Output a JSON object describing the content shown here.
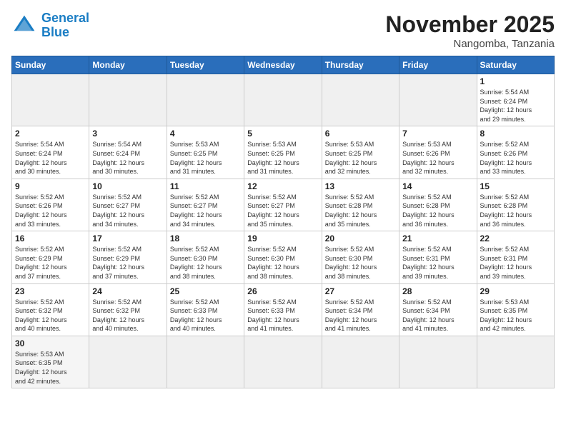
{
  "header": {
    "logo_line1": "General",
    "logo_line2": "Blue",
    "month_title": "November 2025",
    "location": "Nangomba, Tanzania"
  },
  "weekdays": [
    "Sunday",
    "Monday",
    "Tuesday",
    "Wednesday",
    "Thursday",
    "Friday",
    "Saturday"
  ],
  "days": [
    {
      "num": "",
      "info": ""
    },
    {
      "num": "",
      "info": ""
    },
    {
      "num": "",
      "info": ""
    },
    {
      "num": "",
      "info": ""
    },
    {
      "num": "",
      "info": ""
    },
    {
      "num": "",
      "info": ""
    },
    {
      "num": "1",
      "info": "Sunrise: 5:54 AM\nSunset: 6:24 PM\nDaylight: 12 hours\nand 29 minutes."
    },
    {
      "num": "2",
      "info": "Sunrise: 5:54 AM\nSunset: 6:24 PM\nDaylight: 12 hours\nand 30 minutes."
    },
    {
      "num": "3",
      "info": "Sunrise: 5:54 AM\nSunset: 6:24 PM\nDaylight: 12 hours\nand 30 minutes."
    },
    {
      "num": "4",
      "info": "Sunrise: 5:53 AM\nSunset: 6:25 PM\nDaylight: 12 hours\nand 31 minutes."
    },
    {
      "num": "5",
      "info": "Sunrise: 5:53 AM\nSunset: 6:25 PM\nDaylight: 12 hours\nand 31 minutes."
    },
    {
      "num": "6",
      "info": "Sunrise: 5:53 AM\nSunset: 6:25 PM\nDaylight: 12 hours\nand 32 minutes."
    },
    {
      "num": "7",
      "info": "Sunrise: 5:53 AM\nSunset: 6:26 PM\nDaylight: 12 hours\nand 32 minutes."
    },
    {
      "num": "8",
      "info": "Sunrise: 5:52 AM\nSunset: 6:26 PM\nDaylight: 12 hours\nand 33 minutes."
    },
    {
      "num": "9",
      "info": "Sunrise: 5:52 AM\nSunset: 6:26 PM\nDaylight: 12 hours\nand 33 minutes."
    },
    {
      "num": "10",
      "info": "Sunrise: 5:52 AM\nSunset: 6:27 PM\nDaylight: 12 hours\nand 34 minutes."
    },
    {
      "num": "11",
      "info": "Sunrise: 5:52 AM\nSunset: 6:27 PM\nDaylight: 12 hours\nand 34 minutes."
    },
    {
      "num": "12",
      "info": "Sunrise: 5:52 AM\nSunset: 6:27 PM\nDaylight: 12 hours\nand 35 minutes."
    },
    {
      "num": "13",
      "info": "Sunrise: 5:52 AM\nSunset: 6:28 PM\nDaylight: 12 hours\nand 35 minutes."
    },
    {
      "num": "14",
      "info": "Sunrise: 5:52 AM\nSunset: 6:28 PM\nDaylight: 12 hours\nand 36 minutes."
    },
    {
      "num": "15",
      "info": "Sunrise: 5:52 AM\nSunset: 6:28 PM\nDaylight: 12 hours\nand 36 minutes."
    },
    {
      "num": "16",
      "info": "Sunrise: 5:52 AM\nSunset: 6:29 PM\nDaylight: 12 hours\nand 37 minutes."
    },
    {
      "num": "17",
      "info": "Sunrise: 5:52 AM\nSunset: 6:29 PM\nDaylight: 12 hours\nand 37 minutes."
    },
    {
      "num": "18",
      "info": "Sunrise: 5:52 AM\nSunset: 6:30 PM\nDaylight: 12 hours\nand 38 minutes."
    },
    {
      "num": "19",
      "info": "Sunrise: 5:52 AM\nSunset: 6:30 PM\nDaylight: 12 hours\nand 38 minutes."
    },
    {
      "num": "20",
      "info": "Sunrise: 5:52 AM\nSunset: 6:30 PM\nDaylight: 12 hours\nand 38 minutes."
    },
    {
      "num": "21",
      "info": "Sunrise: 5:52 AM\nSunset: 6:31 PM\nDaylight: 12 hours\nand 39 minutes."
    },
    {
      "num": "22",
      "info": "Sunrise: 5:52 AM\nSunset: 6:31 PM\nDaylight: 12 hours\nand 39 minutes."
    },
    {
      "num": "23",
      "info": "Sunrise: 5:52 AM\nSunset: 6:32 PM\nDaylight: 12 hours\nand 40 minutes."
    },
    {
      "num": "24",
      "info": "Sunrise: 5:52 AM\nSunset: 6:32 PM\nDaylight: 12 hours\nand 40 minutes."
    },
    {
      "num": "25",
      "info": "Sunrise: 5:52 AM\nSunset: 6:33 PM\nDaylight: 12 hours\nand 40 minutes."
    },
    {
      "num": "26",
      "info": "Sunrise: 5:52 AM\nSunset: 6:33 PM\nDaylight: 12 hours\nand 41 minutes."
    },
    {
      "num": "27",
      "info": "Sunrise: 5:52 AM\nSunset: 6:34 PM\nDaylight: 12 hours\nand 41 minutes."
    },
    {
      "num": "28",
      "info": "Sunrise: 5:52 AM\nSunset: 6:34 PM\nDaylight: 12 hours\nand 41 minutes."
    },
    {
      "num": "29",
      "info": "Sunrise: 5:53 AM\nSunset: 6:35 PM\nDaylight: 12 hours\nand 42 minutes."
    },
    {
      "num": "30",
      "info": "Sunrise: 5:53 AM\nSunset: 6:35 PM\nDaylight: 12 hours\nand 42 minutes."
    },
    {
      "num": "",
      "info": ""
    },
    {
      "num": "",
      "info": ""
    },
    {
      "num": "",
      "info": ""
    },
    {
      "num": "",
      "info": ""
    },
    {
      "num": "",
      "info": ""
    },
    {
      "num": "",
      "info": ""
    }
  ]
}
